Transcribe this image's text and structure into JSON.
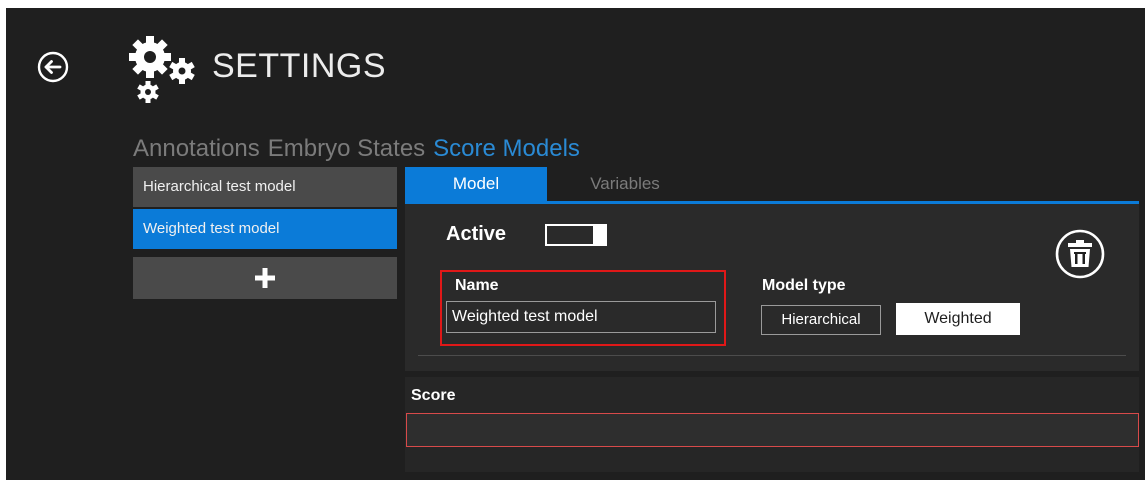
{
  "header": {
    "title": "SETTINGS",
    "back_icon": "circle-arrow-left-icon",
    "settings_icon": "gears-icon"
  },
  "top_tabs": [
    {
      "label": "Annotations",
      "active": false
    },
    {
      "label": "Embryo States",
      "active": false
    },
    {
      "label": "Score Models",
      "active": true
    }
  ],
  "model_list": {
    "items": [
      {
        "label": "Hierarchical test model",
        "selected": false
      },
      {
        "label": "Weighted test model",
        "selected": true
      }
    ],
    "add_icon": "plus-icon"
  },
  "detail_tabs": [
    {
      "label": "Model",
      "active": true
    },
    {
      "label": "Variables",
      "active": false
    }
  ],
  "model": {
    "active_label": "Active",
    "active": true,
    "name_label": "Name",
    "name_value": "Weighted test model",
    "model_type_label": "Model type",
    "model_types": [
      {
        "label": "Hierarchical",
        "selected": false
      },
      {
        "label": "Weighted",
        "selected": true
      }
    ],
    "delete_icon": "trash-icon"
  },
  "score": {
    "label": "Score",
    "value": ""
  },
  "colors": {
    "background": "#1f1f1f",
    "accent": "#0b7bd8",
    "accent_text": "#2a8ad4",
    "highlight": "#e01818",
    "list_item": "#4a4a4a"
  }
}
